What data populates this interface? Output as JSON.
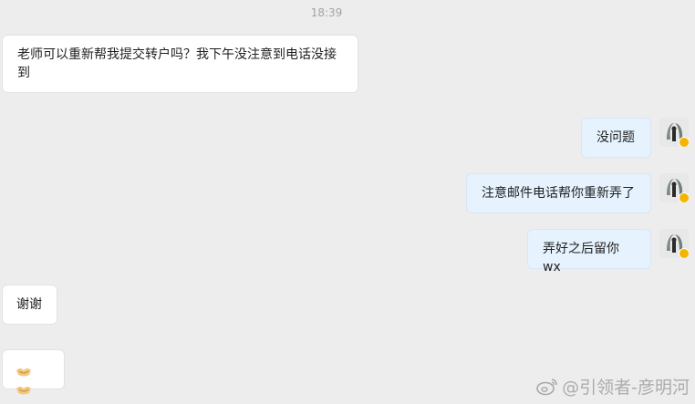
{
  "chat": {
    "timestamp": "18:39",
    "messages": [
      {
        "side": "left",
        "text": "老师可以重新帮我提交转户吗？我下午没注意到电话没接到"
      },
      {
        "side": "right",
        "text": "没问题"
      },
      {
        "side": "right",
        "text": "注意邮件电话帮你重新弄了"
      },
      {
        "side": "right",
        "text": "弄好之后留你wx"
      },
      {
        "side": "left",
        "text": "谢谢"
      },
      {
        "side": "left",
        "emoji": "handshake-emoji"
      }
    ]
  },
  "watermark": {
    "text": "@引领者-彦明河"
  },
  "colors": {
    "background": "#ededed",
    "left_bubble": "#ffffff",
    "right_bubble": "#e6f3fe",
    "timestamp": "#a3a3a3",
    "badge": "#f4b400"
  }
}
